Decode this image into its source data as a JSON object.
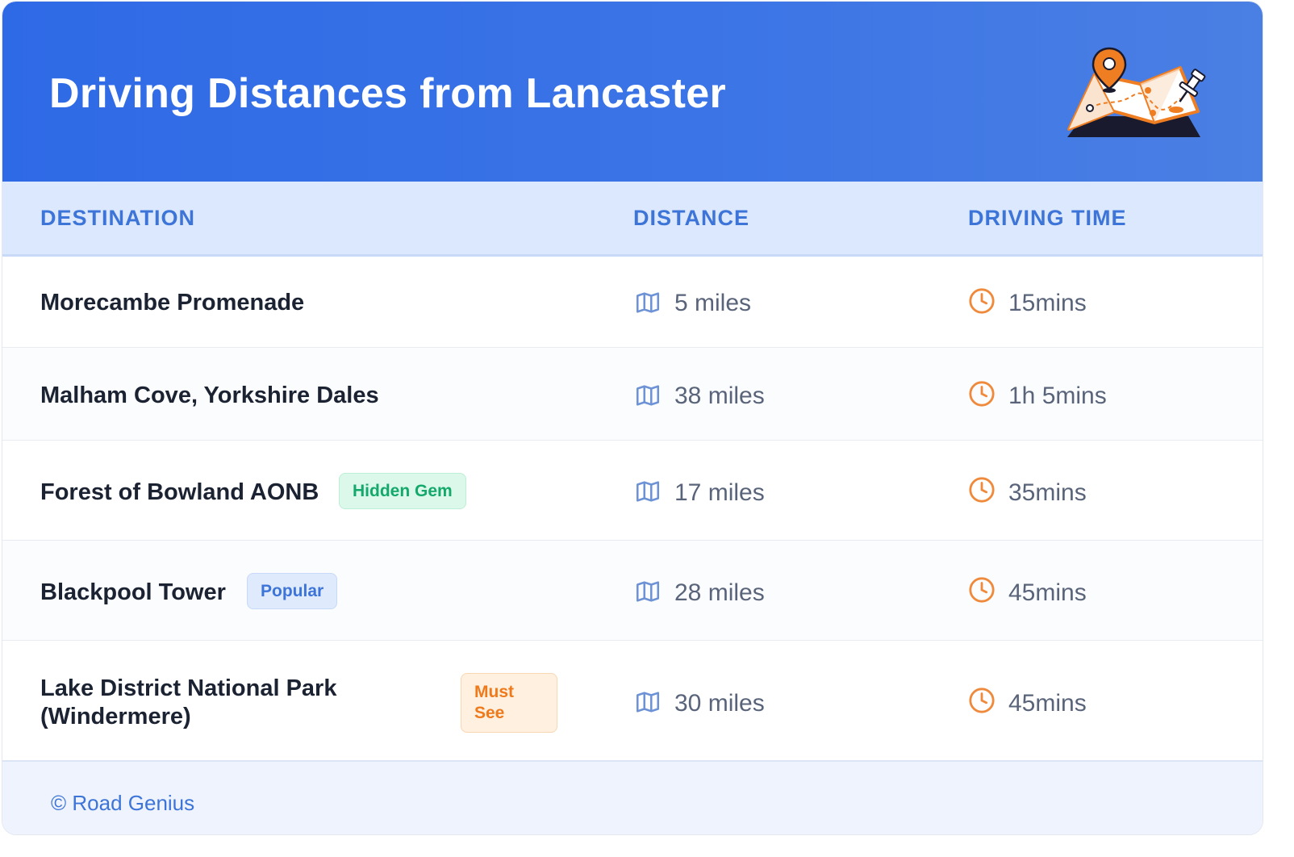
{
  "header": {
    "title": "Driving Distances from Lancaster"
  },
  "table": {
    "columns": [
      "DESTINATION",
      "DISTANCE",
      "DRIVING TIME"
    ],
    "rows": [
      {
        "destination": "Morecambe Promenade",
        "badge": "",
        "distance": "5 miles",
        "time": "15mins"
      },
      {
        "destination": "Malham Cove, Yorkshire Dales",
        "badge": "",
        "distance": "38 miles",
        "time": "1h 5mins"
      },
      {
        "destination": "Forest of Bowland AONB",
        "badge": "Hidden Gem",
        "distance": "17 miles",
        "time": "35mins"
      },
      {
        "destination": "Blackpool Tower",
        "badge": "Popular",
        "distance": "28 miles",
        "time": "45mins"
      },
      {
        "destination_line1": "Lake District National Park",
        "destination_line2": "(Windermere)",
        "badge": "Must See",
        "distance": "30 miles",
        "time": "45mins"
      }
    ]
  },
  "footer": {
    "credit": "© Road Genius"
  },
  "icons": {
    "distance": "map-icon",
    "time": "clock-icon",
    "header": "map-pin-illustration"
  },
  "colors": {
    "header_gradient_start": "#2f6ae6",
    "header_gradient_end": "#4a7fe3",
    "accent_blue": "#3d74d8",
    "clock_orange": "#ef8a3c",
    "badge_green": "#14a86b",
    "badge_orange": "#ee7a1b"
  }
}
